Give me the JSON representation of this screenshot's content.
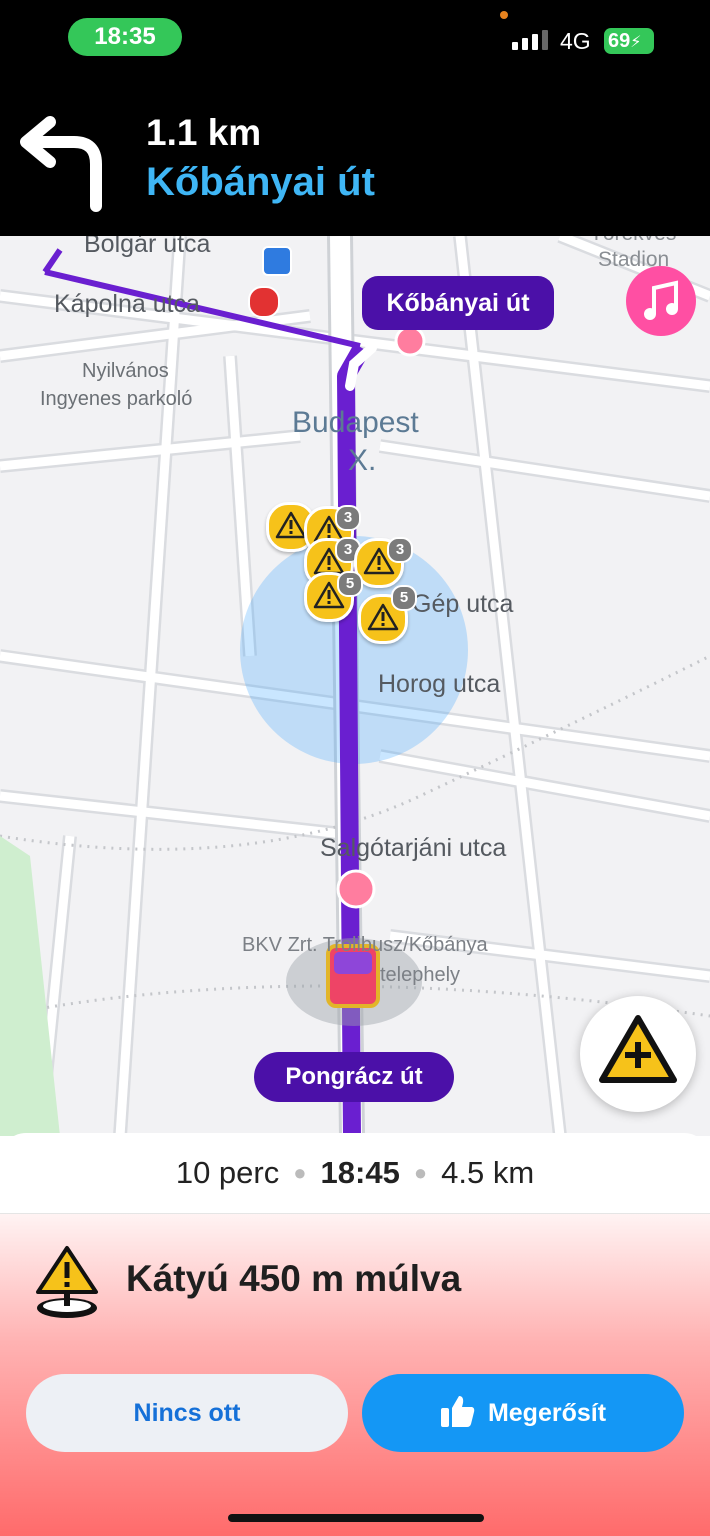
{
  "status_bar": {
    "time": "18:35",
    "network": "4G",
    "battery": "69",
    "icons": [
      "signal-icon",
      "charging-icon"
    ]
  },
  "navigation": {
    "turn_icon": "turn-left-arrow-icon",
    "distance": "1.1 km",
    "street": "Kőbányai út"
  },
  "map": {
    "labels": {
      "bolgar": "Bolgár utca",
      "kapolna": "Kápolna utca",
      "parking_line1": "Nyilvános",
      "parking_line2": "Ingyenes parkoló",
      "district_line1": "Budapest",
      "district_line2": "X.",
      "gep": "Gép utca",
      "horog": "Horog utca",
      "salgotarjani": "Salgótarjáni utca",
      "bkv_line1": "BKV Zrt. Trolibusz/Kőbánya",
      "bkv_line2": "telephely",
      "stadium_line1": "Törekvés",
      "stadium_line2": "Stadion"
    },
    "callouts": {
      "next_street": "Kőbányai út",
      "current_street": "Pongrácz út"
    },
    "hazard_counts": [
      "3",
      "3",
      "3",
      "5",
      "5"
    ],
    "colors": {
      "route": "#6a1fd0",
      "callout": "#4b10a8",
      "hazard": "#f6c21a",
      "accuracy": "#3ea6ff"
    }
  },
  "buttons": {
    "music_icon": "music-note-icon",
    "report_icon": "report-hazard-icon"
  },
  "eta": {
    "duration": "10 perc",
    "arrival": "18:45",
    "distance": "4.5 km"
  },
  "alert": {
    "icon": "pothole-warning-icon",
    "title": "Kátyú 450 m múlva",
    "not_there_label": "Nincs ott",
    "confirm_label": "Megerősít",
    "confirm_icon": "thumbs-up-icon"
  }
}
